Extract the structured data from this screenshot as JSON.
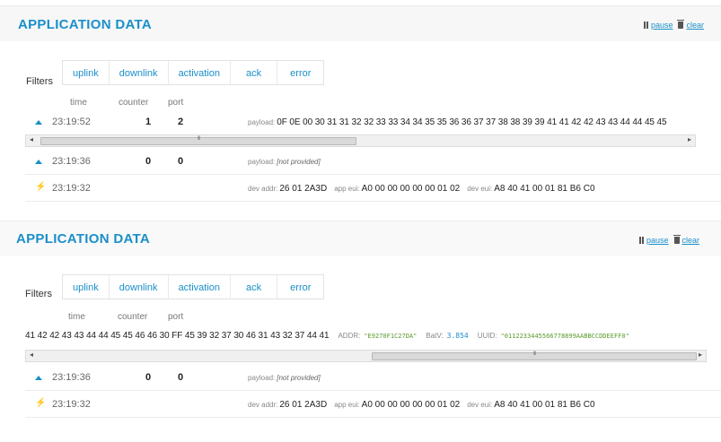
{
  "panels": [
    {
      "title": "APPLICATION DATA",
      "pause_label": "pause",
      "clear_label": "clear",
      "filters_label": "Filters",
      "tabs": [
        "uplink",
        "downlink",
        "activation",
        "ack",
        "error"
      ],
      "columns": {
        "time": "time",
        "counter": "counter",
        "port": "port"
      },
      "rows": [
        {
          "type": "uplink",
          "time": "23:19:52",
          "counter": "1",
          "port": "2",
          "payload_label": "payload:",
          "payload": "0F 0E 00 30 31 31 32 32 33 33 34 34 35 35 36 36 37 37 38 38 39 39 41 41 42 42 43 43 44 44 45 45"
        },
        {
          "type": "uplink",
          "time": "23:19:36",
          "counter": "0",
          "port": "0",
          "payload_label": "payload:",
          "payload": "[not provided]"
        },
        {
          "type": "activation",
          "time": "23:19:32",
          "dev_addr_label": "dev addr:",
          "dev_addr": "26 01 2A3D",
          "app_eui_label": "app eui:",
          "app_eui": "A0 00 00 00 00 00 01 02",
          "dev_eui_label": "dev eui:",
          "dev_eui": "A8 40 41 00 01 81 B6 C0"
        }
      ]
    },
    {
      "title": "APPLICATION DATA",
      "pause_label": "pause",
      "clear_label": "clear",
      "filters_label": "Filters",
      "tabs": [
        "uplink",
        "downlink",
        "activation",
        "ack",
        "error"
      ],
      "columns": {
        "time": "time",
        "counter": "counter",
        "port": "port"
      },
      "scrolled_payload": "41 42 42 43 43 44 44 45 45 46 46 30 FF 45 39 32 37 30 46 31 43 32 37 44 41",
      "decoded": {
        "addr_key": "ADDR:",
        "addr_val": "\"E9270F1C27DA\"",
        "batv_key": "BatV:",
        "batv_val": "3.854",
        "uuid_key": "UUID:",
        "uuid_val": "\"0112233445566778899AABBCCDDEEFF0\""
      },
      "rows": [
        {
          "type": "uplink",
          "time": "23:19:36",
          "counter": "0",
          "port": "0",
          "payload_label": "payload:",
          "payload": "[not provided]"
        },
        {
          "type": "activation",
          "time": "23:19:32",
          "dev_addr_label": "dev addr:",
          "dev_addr": "26 01 2A3D",
          "app_eui_label": "app eui:",
          "app_eui": "A0 00 00 00 00 00 01 02",
          "dev_eui_label": "dev eui:",
          "dev_eui": "A8 40 41 00 01 81 B6 C0"
        }
      ]
    }
  ],
  "icons": {
    "pause": "pause-icon",
    "clear": "trash-icon",
    "uplink": "arrow-up-icon",
    "activation": "lightning-icon"
  },
  "colors": {
    "accent": "#1a8fc9",
    "activation": "#f0b020",
    "decoded_string": "#5a9a2a"
  }
}
